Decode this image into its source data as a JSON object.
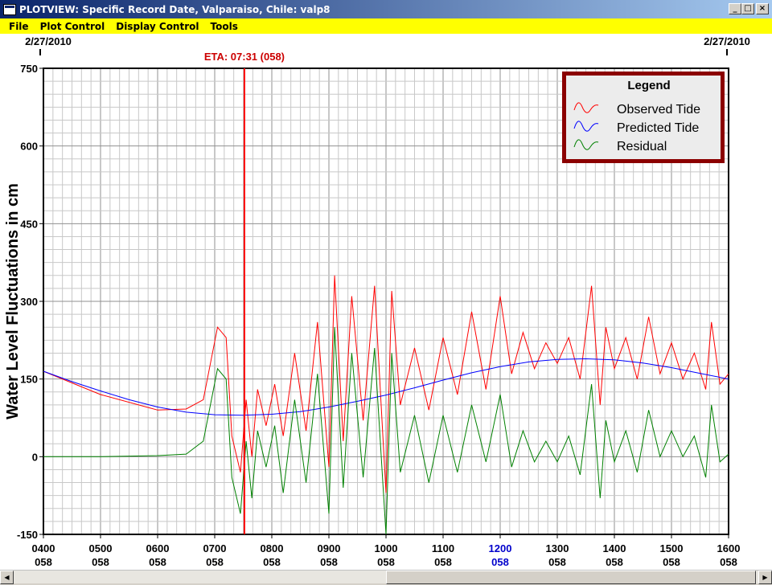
{
  "window": {
    "title": "PLOTVIEW: Specific Record Date, Valparaiso, Chile: valp8",
    "minimize_glyph": "_",
    "maximize_glyph": "□",
    "close_glyph": "×"
  },
  "menu": [
    "File",
    "Plot Control",
    "Display Control",
    "Tools"
  ],
  "scrollbar": {
    "left_glyph": "◀",
    "right_glyph": "▶"
  },
  "chart_data": {
    "type": "line",
    "ylabel": "Water Level Fluctuations in cm",
    "ylim": [
      -150,
      750
    ],
    "y_ticks": [
      "750",
      "600",
      "450",
      "300",
      "150",
      "0",
      "-150"
    ],
    "y_tick_values": [
      750,
      600,
      450,
      300,
      150,
      0,
      -150
    ],
    "xlim": [
      4.0,
      16.0
    ],
    "x_ticks": [
      {
        "value": 4,
        "label": "0400",
        "day": "058"
      },
      {
        "value": 5,
        "label": "0500",
        "day": "058"
      },
      {
        "value": 6,
        "label": "0600",
        "day": "058"
      },
      {
        "value": 7,
        "label": "0700",
        "day": "058"
      },
      {
        "value": 8,
        "label": "0800",
        "day": "058"
      },
      {
        "value": 9,
        "label": "0900",
        "day": "058"
      },
      {
        "value": 10,
        "label": "1000",
        "day": "058"
      },
      {
        "value": 11,
        "label": "1100",
        "day": "058"
      },
      {
        "value": 12,
        "label": "1200",
        "day": "058",
        "highlight": true
      },
      {
        "value": 13,
        "label": "1300",
        "day": "058"
      },
      {
        "value": 14,
        "label": "1400",
        "day": "058"
      },
      {
        "value": 15,
        "label": "1500",
        "day": "058"
      },
      {
        "value": 16,
        "label": "1600",
        "day": "058"
      }
    ],
    "date_left": "2/27/2010",
    "date_right": "2/27/2010",
    "eta": {
      "label": "ETA: 07:31 (058)",
      "x": 7.52
    },
    "legend": {
      "title": "Legend",
      "entries": [
        {
          "name": "Observed Tide",
          "color": "#ff0000"
        },
        {
          "name": "Predicted Tide",
          "color": "#0000ff"
        },
        {
          "name": "Residual",
          "color": "#008000"
        }
      ]
    },
    "grid": true,
    "series": [
      {
        "name": "Observed Tide",
        "color": "#ff0000",
        "x": [
          4.0,
          5.0,
          6.0,
          6.5,
          6.8,
          7.05,
          7.2,
          7.3,
          7.45,
          7.55,
          7.65,
          7.75,
          7.9,
          8.05,
          8.2,
          8.4,
          8.6,
          8.8,
          9.0,
          9.1,
          9.25,
          9.4,
          9.6,
          9.8,
          10.0,
          10.1,
          10.25,
          10.5,
          10.75,
          11.0,
          11.25,
          11.5,
          11.75,
          12.0,
          12.2,
          12.4,
          12.6,
          12.8,
          13.0,
          13.2,
          13.4,
          13.6,
          13.75,
          13.85,
          14.0,
          14.2,
          14.4,
          14.6,
          14.8,
          15.0,
          15.2,
          15.4,
          15.6,
          15.7,
          15.85,
          16.0
        ],
        "y": [
          165,
          120,
          90,
          92,
          110,
          250,
          230,
          40,
          -30,
          110,
          0,
          130,
          60,
          140,
          40,
          200,
          50,
          260,
          -20,
          350,
          30,
          310,
          70,
          330,
          -70,
          320,
          100,
          210,
          90,
          230,
          120,
          280,
          130,
          310,
          160,
          240,
          170,
          220,
          180,
          230,
          150,
          330,
          100,
          250,
          170,
          230,
          150,
          270,
          160,
          220,
          150,
          200,
          130,
          260,
          140,
          160
        ]
      },
      {
        "name": "Predicted Tide",
        "color": "#0000ff",
        "x": [
          4.0,
          4.5,
          5.0,
          5.5,
          6.0,
          6.5,
          7.0,
          7.5,
          8.0,
          8.5,
          9.0,
          9.5,
          10.0,
          10.5,
          11.0,
          11.5,
          12.0,
          12.5,
          13.0,
          13.5,
          14.0,
          14.5,
          15.0,
          15.5,
          16.0
        ],
        "y": [
          165,
          145,
          127,
          110,
          96,
          86,
          81,
          80,
          82,
          87,
          96,
          107,
          119,
          133,
          148,
          162,
          174,
          183,
          188,
          189,
          187,
          181,
          172,
          161,
          150
        ]
      },
      {
        "name": "Residual",
        "color": "#008000",
        "x": [
          4.0,
          5.0,
          6.0,
          6.5,
          6.8,
          7.05,
          7.2,
          7.3,
          7.45,
          7.55,
          7.65,
          7.75,
          7.9,
          8.05,
          8.2,
          8.4,
          8.6,
          8.8,
          9.0,
          9.1,
          9.25,
          9.4,
          9.6,
          9.8,
          10.0,
          10.1,
          10.25,
          10.5,
          10.75,
          11.0,
          11.25,
          11.5,
          11.75,
          12.0,
          12.2,
          12.4,
          12.6,
          12.8,
          13.0,
          13.2,
          13.4,
          13.6,
          13.75,
          13.85,
          14.0,
          14.2,
          14.4,
          14.6,
          14.8,
          15.0,
          15.2,
          15.4,
          15.6,
          15.7,
          15.85,
          16.0
        ],
        "y": [
          0,
          0,
          2,
          5,
          30,
          170,
          150,
          -40,
          -110,
          30,
          -80,
          50,
          -20,
          60,
          -70,
          110,
          -50,
          160,
          -110,
          250,
          -60,
          200,
          -40,
          210,
          -150,
          200,
          -30,
          80,
          -50,
          80,
          -30,
          100,
          -10,
          120,
          -20,
          50,
          -10,
          30,
          -10,
          40,
          -35,
          140,
          -80,
          70,
          -10,
          50,
          -30,
          90,
          0,
          50,
          0,
          40,
          -40,
          100,
          -10,
          5
        ]
      }
    ]
  }
}
